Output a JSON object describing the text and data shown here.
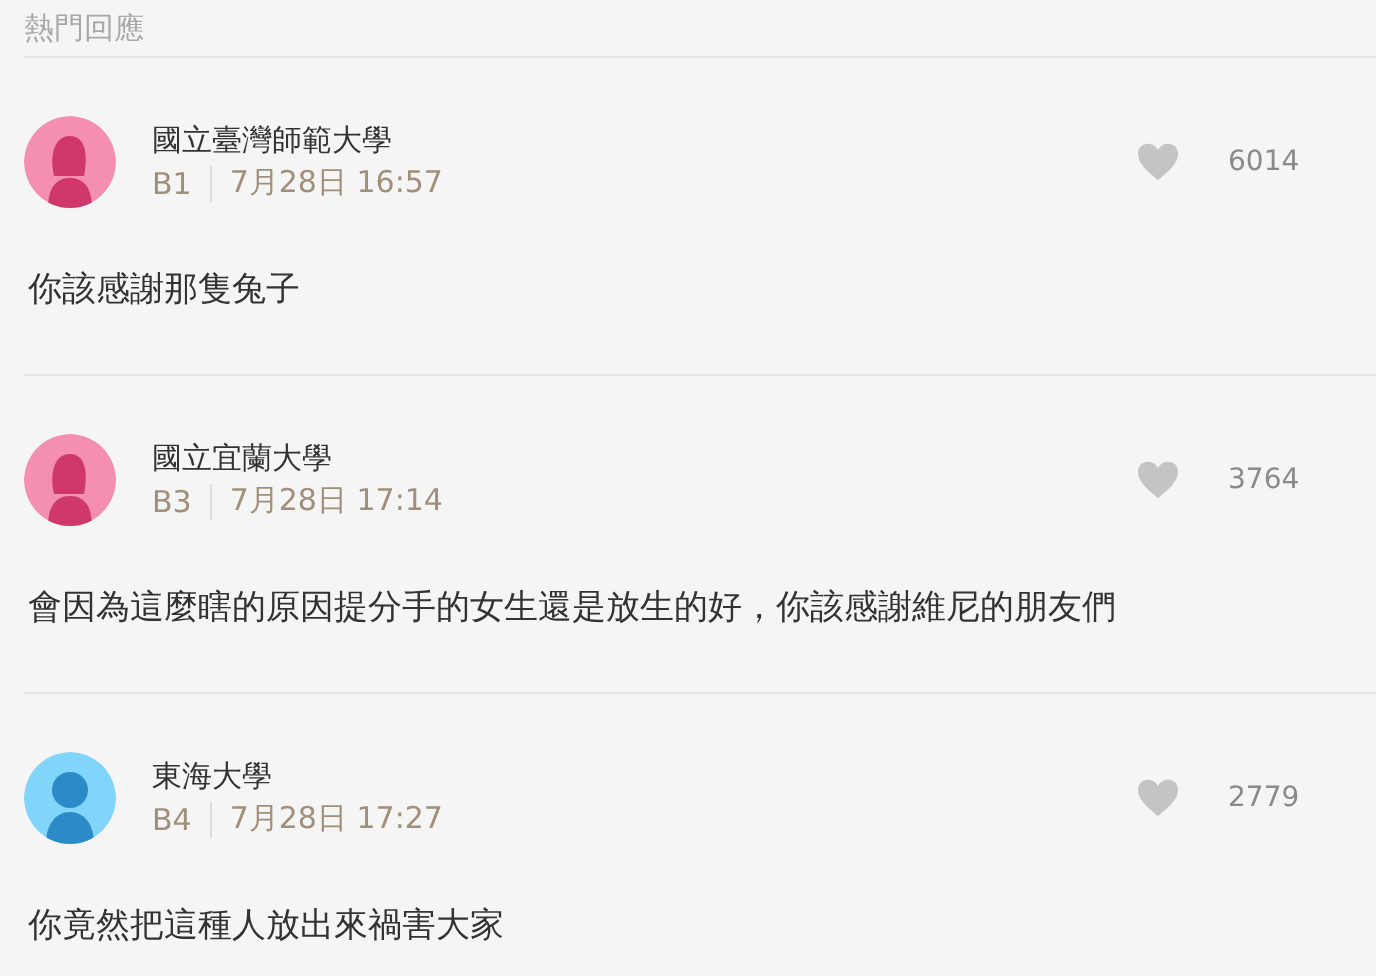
{
  "section_title": "熱門回應",
  "replies": [
    {
      "school": "國立臺灣師範大學",
      "floor": "B1",
      "time": "7月28日 16:57",
      "likes": "6014",
      "avatar": {
        "kind": "female"
      },
      "content": "你該感謝那隻兔子"
    },
    {
      "school": "國立宜蘭大學",
      "floor": "B3",
      "time": "7月28日 17:14",
      "likes": "3764",
      "avatar": {
        "kind": "female"
      },
      "content": "會因為這麼瞎的原因提分手的女生還是放生的好，你該感謝維尼的朋友們"
    },
    {
      "school": "東海大學",
      "floor": "B4",
      "time": "7月28日 17:27",
      "likes": "2779",
      "avatar": {
        "kind": "male"
      },
      "content": "你竟然把這種人放出來禍害大家"
    }
  ]
}
